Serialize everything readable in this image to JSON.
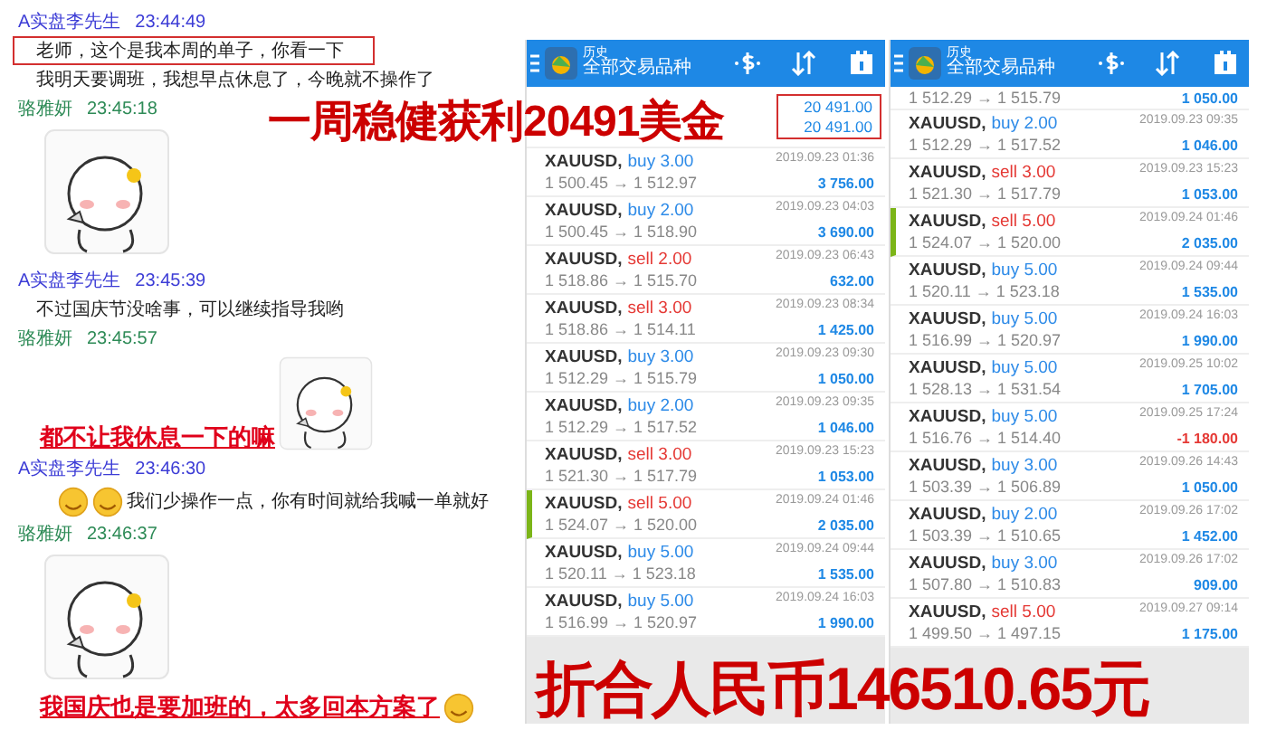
{
  "chat": {
    "messages": [
      {
        "kind": "sender",
        "name": "A实盘李先生",
        "time": "23:44:49",
        "color": "#3d3dd6"
      },
      {
        "kind": "text",
        "text": "老师，这个是我本周的单子，你看一下",
        "highlighted": true
      },
      {
        "kind": "text",
        "text": "我明天要调班，我想早点休息了，今晚就不操作了",
        "highlighted": false
      },
      {
        "kind": "sender",
        "name": "骆雅妍",
        "time": "23:45:18",
        "color": "#2e8b57"
      },
      {
        "kind": "sticker"
      },
      {
        "kind": "sender",
        "name": "A实盘李先生",
        "time": "23:45:39",
        "color": "#3d3dd6"
      },
      {
        "kind": "text",
        "text": "不过国庆节没啥事，可以继续指导我哟",
        "highlighted": false
      },
      {
        "kind": "sender",
        "name": "骆雅妍",
        "time": "23:45:57",
        "color": "#2e8b57"
      },
      {
        "kind": "shout_sticker",
        "text": "都不让我休息一下的嘛"
      },
      {
        "kind": "sender",
        "name": "A实盘李先生",
        "time": "23:46:30",
        "color": "#3d3dd6"
      },
      {
        "kind": "emoji_text",
        "text": "我们少操作一点，你有时间就给我喊一单就好"
      },
      {
        "kind": "sender",
        "name": "骆雅妍",
        "time": "23:46:37",
        "color": "#2e8b57"
      },
      {
        "kind": "sticker"
      },
      {
        "kind": "shout_emoji",
        "text": "我国庆也是要加班的，太多回本方案了"
      }
    ]
  },
  "phones": [
    {
      "header": {
        "subtitle": "历史",
        "title": "全部交易品种"
      },
      "summary": {
        "highlighted": true,
        "values": [
          "20 491.00",
          "20 491.00"
        ]
      },
      "trades": [
        {
          "symbol": "XAUUSD,",
          "order": "buy 3.00",
          "kind": "buy",
          "time": "2019.09.23 01:36",
          "prices": "1 500.45 → 1 512.97",
          "profit": "3 756.00",
          "loss": false,
          "selected": false
        },
        {
          "symbol": "XAUUSD,",
          "order": "buy 2.00",
          "kind": "buy",
          "time": "2019.09.23 04:03",
          "prices": "1 500.45 → 1 518.90",
          "profit": "3 690.00",
          "loss": false,
          "selected": false
        },
        {
          "symbol": "XAUUSD,",
          "order": "sell 2.00",
          "kind": "sell",
          "time": "2019.09.23 06:43",
          "prices": "1 518.86 → 1 515.70",
          "profit": "632.00",
          "loss": false,
          "selected": false
        },
        {
          "symbol": "XAUUSD,",
          "order": "sell 3.00",
          "kind": "sell",
          "time": "2019.09.23 08:34",
          "prices": "1 518.86 → 1 514.11",
          "profit": "1 425.00",
          "loss": false,
          "selected": false
        },
        {
          "symbol": "XAUUSD,",
          "order": "buy 3.00",
          "kind": "buy",
          "time": "2019.09.23 09:30",
          "prices": "1 512.29 → 1 515.79",
          "profit": "1 050.00",
          "loss": false,
          "selected": false
        },
        {
          "symbol": "XAUUSD,",
          "order": "buy 2.00",
          "kind": "buy",
          "time": "2019.09.23 09:35",
          "prices": "1 512.29 → 1 517.52",
          "profit": "1 046.00",
          "loss": false,
          "selected": false
        },
        {
          "symbol": "XAUUSD,",
          "order": "sell 3.00",
          "kind": "sell",
          "time": "2019.09.23 15:23",
          "prices": "1 521.30 → 1 517.79",
          "profit": "1 053.00",
          "loss": false,
          "selected": false
        },
        {
          "symbol": "XAUUSD,",
          "order": "sell 5.00",
          "kind": "sell",
          "time": "2019.09.24 01:46",
          "prices": "1 524.07 → 1 520.00",
          "profit": "2 035.00",
          "loss": false,
          "selected": true
        },
        {
          "symbol": "XAUUSD,",
          "order": "buy 5.00",
          "kind": "buy",
          "time": "2019.09.24 09:44",
          "prices": "1 520.11 → 1 523.18",
          "profit": "1 535.00",
          "loss": false,
          "selected": false
        },
        {
          "symbol": "XAUUSD,",
          "order": "buy 5.00",
          "kind": "buy",
          "time": "2019.09.24 16:03",
          "prices": "1 516.99 → 1 520.97",
          "profit": "1 990.00",
          "loss": false,
          "selected": false
        }
      ]
    },
    {
      "header": {
        "subtitle": "历史",
        "title": "全部交易品种"
      },
      "partial_row": {
        "prices": "1 512.29 → 1 515.79",
        "profit": "1 050.00"
      },
      "trades": [
        {
          "symbol": "XAUUSD,",
          "order": "buy 2.00",
          "kind": "buy",
          "time": "2019.09.23 09:35",
          "prices": "1 512.29 → 1 517.52",
          "profit": "1 046.00",
          "loss": false,
          "selected": false
        },
        {
          "symbol": "XAUUSD,",
          "order": "sell 3.00",
          "kind": "sell",
          "time": "2019.09.23 15:23",
          "prices": "1 521.30 → 1 517.79",
          "profit": "1 053.00",
          "loss": false,
          "selected": false
        },
        {
          "symbol": "XAUUSD,",
          "order": "sell 5.00",
          "kind": "sell",
          "time": "2019.09.24 01:46",
          "prices": "1 524.07 → 1 520.00",
          "profit": "2 035.00",
          "loss": false,
          "selected": true
        },
        {
          "symbol": "XAUUSD,",
          "order": "buy 5.00",
          "kind": "buy",
          "time": "2019.09.24 09:44",
          "prices": "1 520.11 → 1 523.18",
          "profit": "1 535.00",
          "loss": false,
          "selected": false
        },
        {
          "symbol": "XAUUSD,",
          "order": "buy 5.00",
          "kind": "buy",
          "time": "2019.09.24 16:03",
          "prices": "1 516.99 → 1 520.97",
          "profit": "1 990.00",
          "loss": false,
          "selected": false
        },
        {
          "symbol": "XAUUSD,",
          "order": "buy 5.00",
          "kind": "buy",
          "time": "2019.09.25 10:02",
          "prices": "1 528.13 → 1 531.54",
          "profit": "1 705.00",
          "loss": false,
          "selected": false
        },
        {
          "symbol": "XAUUSD,",
          "order": "buy 5.00",
          "kind": "buy",
          "time": "2019.09.25 17:24",
          "prices": "1 516.76 → 1 514.40",
          "profit": "-1 180.00",
          "loss": true,
          "selected": false
        },
        {
          "symbol": "XAUUSD,",
          "order": "buy 3.00",
          "kind": "buy",
          "time": "2019.09.26 14:43",
          "prices": "1 503.39 → 1 506.89",
          "profit": "1 050.00",
          "loss": false,
          "selected": false
        },
        {
          "symbol": "XAUUSD,",
          "order": "buy 2.00",
          "kind": "buy",
          "time": "2019.09.26 17:02",
          "prices": "1 503.39 → 1 510.65",
          "profit": "1 452.00",
          "loss": false,
          "selected": false
        },
        {
          "symbol": "XAUUSD,",
          "order": "buy 3.00",
          "kind": "buy",
          "time": "2019.09.26 17:02",
          "prices": "1 507.80 → 1 510.83",
          "profit": "909.00",
          "loss": false,
          "selected": false
        },
        {
          "symbol": "XAUUSD,",
          "order": "sell 5.00",
          "kind": "sell",
          "time": "2019.09.27 09:14",
          "prices": "1 499.50 → 1 497.15",
          "profit": "1 175.00",
          "loss": false,
          "selected": false
        }
      ]
    }
  ],
  "overlays": {
    "headline": "一周稳健获利20491美金",
    "footer": "折合人民币146510.65元"
  }
}
